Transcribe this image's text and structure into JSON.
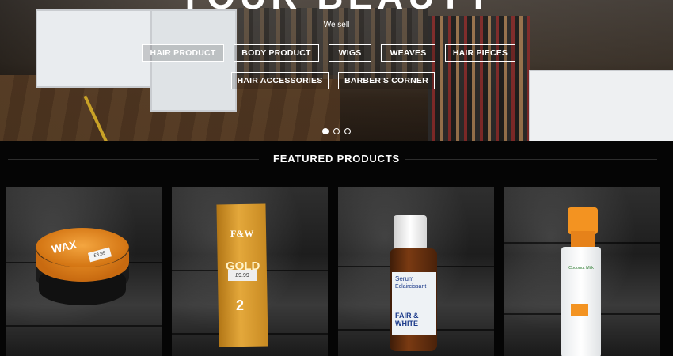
{
  "hero": {
    "title": "YOUR BEAUTY",
    "subtitle": "We sell",
    "buttons": [
      {
        "label": "HAIR PRODUCT"
      },
      {
        "label": "BODY PRODUCT"
      },
      {
        "label": "WIGS"
      },
      {
        "label": "WEAVES"
      },
      {
        "label": "HAIR PIECES"
      },
      {
        "label": "HAIR ACCESSORIES"
      },
      {
        "label": "BARBER'S CORNER"
      }
    ],
    "slides_total": 3,
    "active_slide": 1
  },
  "featured": {
    "title": "FEATURED PRODUCTS",
    "products": [
      {
        "image": "wax-tin-product-photo",
        "label_text": "WAX",
        "price_sticker": "£3.99"
      },
      {
        "image": "fair-and-white-gold-box-photo",
        "brand_text": "F&W",
        "line_text": "GOLD",
        "number_text": "2",
        "price_sticker": "£9.99"
      },
      {
        "image": "fair-and-white-serum-bottle-photo",
        "label_text_1": "Serum",
        "label_text_2": "Éclaircissant",
        "brand_text": "FAIR & WHITE"
      },
      {
        "image": "foam-pump-bottle-photo",
        "label_text": "Coconut Milk"
      }
    ]
  },
  "colors": {
    "background": "#050505",
    "button_border": "#ffffff",
    "accent_orange": "#f39321"
  }
}
